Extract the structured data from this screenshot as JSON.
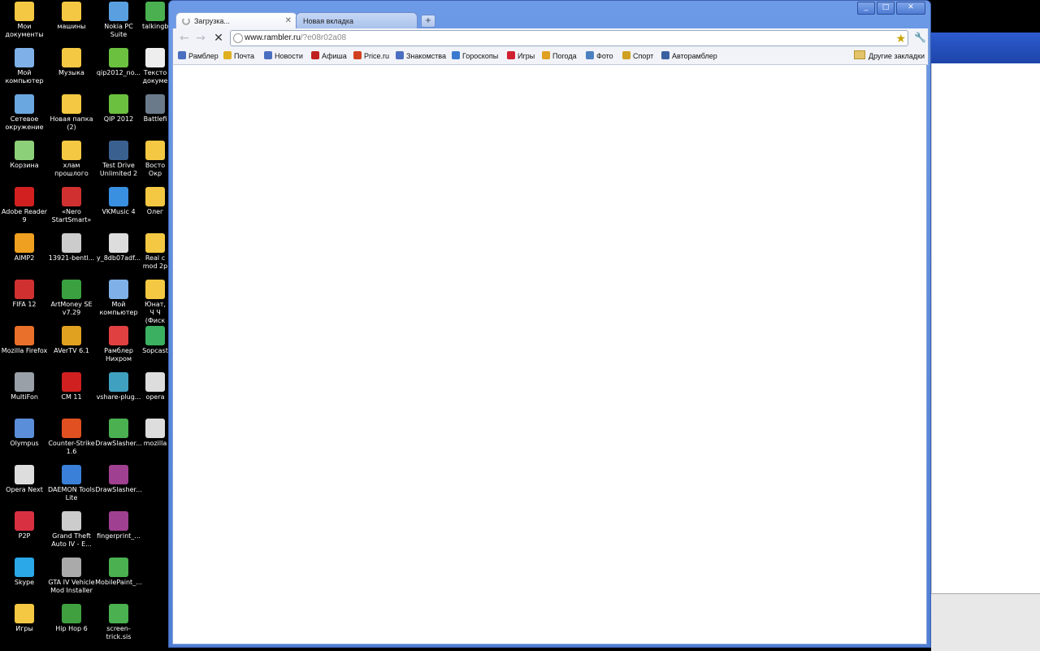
{
  "desktop_icons": [
    {
      "col": 0,
      "row": 0,
      "label": "Мои документы",
      "icon": "folder-documents-icon",
      "color": "#f4c842"
    },
    {
      "col": 0,
      "row": 1,
      "label": "Мой компьютер",
      "icon": "computer-icon",
      "color": "#7fb0e8"
    },
    {
      "col": 0,
      "row": 2,
      "label": "Сетевое окружение",
      "icon": "network-icon",
      "color": "#6aa7e0"
    },
    {
      "col": 0,
      "row": 3,
      "label": "Корзина",
      "icon": "recycle-bin-icon",
      "color": "#8dd07a"
    },
    {
      "col": 0,
      "row": 4,
      "label": "Adobe Reader 9",
      "icon": "adobe-reader-icon",
      "color": "#d22020"
    },
    {
      "col": 0,
      "row": 5,
      "label": "AIMP2",
      "icon": "aimp-icon",
      "color": "#f0a020"
    },
    {
      "col": 0,
      "row": 6,
      "label": "FIFA 12",
      "icon": "fifa-icon",
      "color": "#d03030"
    },
    {
      "col": 0,
      "row": 7,
      "label": "Mozilla Firefox",
      "icon": "firefox-icon",
      "color": "#e8702a"
    },
    {
      "col": 0,
      "row": 8,
      "label": "MultiFon",
      "icon": "multifon-icon",
      "color": "#9aa0a8"
    },
    {
      "col": 0,
      "row": 9,
      "label": "Olympus",
      "icon": "olympus-icon",
      "color": "#5b8ed8"
    },
    {
      "col": 0,
      "row": 10,
      "label": "Opera Next",
      "icon": "opera-icon",
      "color": "#dddddd"
    },
    {
      "col": 0,
      "row": 11,
      "label": "P2P",
      "icon": "p2p-icon",
      "color": "#d83040"
    },
    {
      "col": 0,
      "row": 12,
      "label": "Skype",
      "icon": "skype-icon",
      "color": "#2aa8e8"
    },
    {
      "col": 0,
      "row": 13,
      "label": "Игры",
      "icon": "folder-icon",
      "color": "#f4c842"
    },
    {
      "col": 1,
      "row": 0,
      "label": "машины",
      "icon": "folder-icon",
      "color": "#f4c842"
    },
    {
      "col": 1,
      "row": 1,
      "label": "Музыка",
      "icon": "folder-icon",
      "color": "#f4c842"
    },
    {
      "col": 1,
      "row": 2,
      "label": "Новая папка (2)",
      "icon": "folder-icon",
      "color": "#f4c842"
    },
    {
      "col": 1,
      "row": 3,
      "label": "хлам прошлого",
      "icon": "folder-icon",
      "color": "#f4c842"
    },
    {
      "col": 1,
      "row": 4,
      "label": "«Nero StartSmart»",
      "icon": "nero-icon",
      "color": "#d03030"
    },
    {
      "col": 1,
      "row": 5,
      "label": "13921-bentl...",
      "icon": "gta-iv-icon",
      "color": "#cccccc"
    },
    {
      "col": 1,
      "row": 6,
      "label": "ArtMoney SE v7.29",
      "icon": "artmoney-icon",
      "color": "#3aa040"
    },
    {
      "col": 1,
      "row": 7,
      "label": "AVerTV 6.1",
      "icon": "avertv-icon",
      "color": "#e0a020"
    },
    {
      "col": 1,
      "row": 8,
      "label": "CM 11",
      "icon": "cm-icon",
      "color": "#d02020"
    },
    {
      "col": 1,
      "row": 9,
      "label": "Counter-Strike 1.6",
      "icon": "counter-strike-icon",
      "color": "#e05020"
    },
    {
      "col": 1,
      "row": 10,
      "label": "DAEMON Tools Lite",
      "icon": "daemon-tools-icon",
      "color": "#3a80d8"
    },
    {
      "col": 1,
      "row": 11,
      "label": "Grand Theft Auto IV - E...",
      "icon": "gta-iv-icon",
      "color": "#cccccc"
    },
    {
      "col": 1,
      "row": 12,
      "label": "GTA IV Vehicle Mod Installer",
      "icon": "tools-icon",
      "color": "#aaaaaa"
    },
    {
      "col": 1,
      "row": 13,
      "label": "Hip Hop 6",
      "icon": "hiphop-icon",
      "color": "#40a040"
    },
    {
      "col": 2,
      "row": 0,
      "label": "Nokia PC Suite",
      "icon": "nokia-icon",
      "color": "#5aa0e0"
    },
    {
      "col": 2,
      "row": 1,
      "label": "qip2012_no...",
      "icon": "qip-icon",
      "color": "#6cc040"
    },
    {
      "col": 2,
      "row": 2,
      "label": "QIP 2012",
      "icon": "qip-icon",
      "color": "#6cc040"
    },
    {
      "col": 2,
      "row": 3,
      "label": "Test Drive Unlimited 2",
      "icon": "tdu-icon",
      "color": "#3a6090"
    },
    {
      "col": 2,
      "row": 4,
      "label": "VKMusic 4",
      "icon": "vkmusic-icon",
      "color": "#3a90e0"
    },
    {
      "col": 2,
      "row": 5,
      "label": "y_8db07adf...",
      "icon": "file-icon",
      "color": "#dddddd"
    },
    {
      "col": 2,
      "row": 6,
      "label": "Мой компьютер",
      "icon": "computer-icon",
      "color": "#7fb0e8"
    },
    {
      "col": 2,
      "row": 7,
      "label": "Рамблер Нихром",
      "icon": "nichrome-icon",
      "color": "#e04040"
    },
    {
      "col": 2,
      "row": 8,
      "label": "vshare-plug...",
      "icon": "vshare-icon",
      "color": "#40a0c0"
    },
    {
      "col": 2,
      "row": 9,
      "label": "DrawSlasher...",
      "icon": "sis-icon",
      "color": "#4ab050"
    },
    {
      "col": 2,
      "row": 10,
      "label": "DrawSlasher...",
      "icon": "winrar-icon",
      "color": "#a04090"
    },
    {
      "col": 2,
      "row": 11,
      "label": "fingerprint_...",
      "icon": "winrar-icon",
      "color": "#a04090"
    },
    {
      "col": 2,
      "row": 12,
      "label": "MobilePaint_...",
      "icon": "sis-icon",
      "color": "#4ab050"
    },
    {
      "col": 2,
      "row": 13,
      "label": "screen-trick.sis",
      "icon": "sis-icon",
      "color": "#4ab050"
    },
    {
      "col": 3,
      "row": 0,
      "label": "talkingb",
      "icon": "sis-icon",
      "color": "#4ab050"
    },
    {
      "col": 3,
      "row": 1,
      "label": "Тексто докуме",
      "icon": "document-icon",
      "color": "#eeeeee"
    },
    {
      "col": 3,
      "row": 2,
      "label": "Battlefi",
      "icon": "battlefield-icon",
      "color": "#6a7a8a"
    },
    {
      "col": 3,
      "row": 3,
      "label": "Восто Окр",
      "icon": "folder-icon",
      "color": "#f4c842"
    },
    {
      "col": 3,
      "row": 4,
      "label": "Олег",
      "icon": "folder-icon",
      "color": "#f4c842"
    },
    {
      "col": 3,
      "row": 5,
      "label": "Real c mod 2p",
      "icon": "folder-icon",
      "color": "#f4c842"
    },
    {
      "col": 3,
      "row": 6,
      "label": "Юнат, Ч Ч (Фиск",
      "icon": "folder-icon",
      "color": "#f4c842"
    },
    {
      "col": 3,
      "row": 7,
      "label": "Sopcast",
      "icon": "sopcast-icon",
      "color": "#3ab060"
    },
    {
      "col": 3,
      "row": 8,
      "label": "opera",
      "icon": "file-icon",
      "color": "#dddddd"
    },
    {
      "col": 3,
      "row": 9,
      "label": "mozilla",
      "icon": "file-icon",
      "color": "#dddddd"
    }
  ],
  "browser": {
    "tabs": [
      {
        "label": "Загрузка...",
        "active": true
      },
      {
        "label": "Новая вкладка",
        "active": false
      }
    ],
    "new_tab_label": "+",
    "window_buttons": {
      "minimize": "_",
      "maximize": "□",
      "close": "✕"
    },
    "address": {
      "host": "www.rambler.ru",
      "path": "/?e08r02a08"
    },
    "bookmarks": [
      {
        "label": "Рамблер",
        "icon": "rambler-icon",
        "color": "#4a6fc0"
      },
      {
        "label": "Почта",
        "icon": "mail-icon",
        "color": "#e0b020"
      },
      {
        "label": "Новости",
        "icon": "news-icon",
        "color": "#4a6fc0"
      },
      {
        "label": "Афиша",
        "icon": "afisha-icon",
        "color": "#c02020"
      },
      {
        "label": "Price.ru",
        "icon": "price-icon",
        "color": "#d04020"
      },
      {
        "label": "Знакомства",
        "icon": "dating-icon",
        "color": "#4a6fc0"
      },
      {
        "label": "Гороскопы",
        "icon": "horoscope-icon",
        "color": "#3a7ad0"
      },
      {
        "label": "Игры",
        "icon": "games-icon",
        "color": "#d02030"
      },
      {
        "label": "Погода",
        "icon": "weather-icon",
        "color": "#e0a020"
      },
      {
        "label": "Фото",
        "icon": "photo-icon",
        "color": "#4a80c0"
      },
      {
        "label": "Спорт",
        "icon": "sport-icon",
        "color": "#d0a020"
      },
      {
        "label": "Авторамблер",
        "icon": "auto-icon",
        "color": "#3a60a0"
      }
    ],
    "other_bookmarks": "Другие закладки"
  }
}
